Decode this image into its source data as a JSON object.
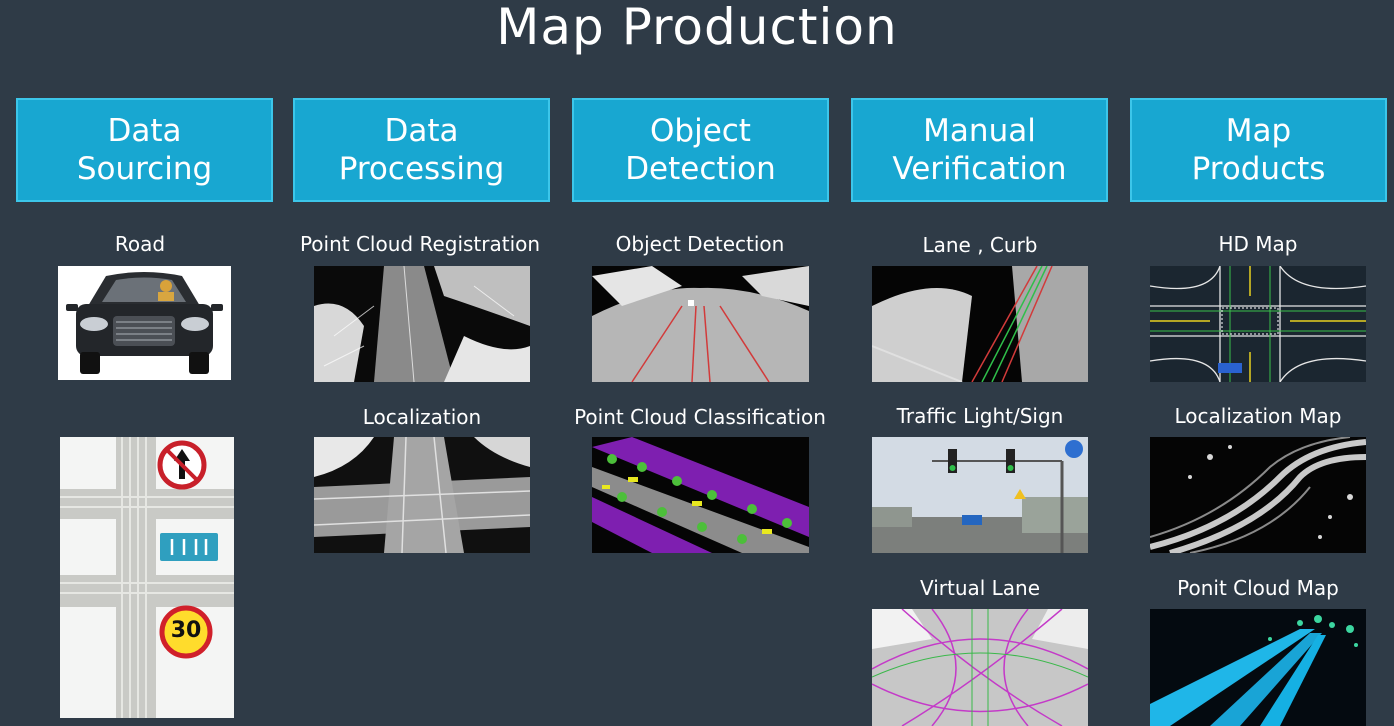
{
  "title": "Map Production",
  "columns": [
    {
      "label": "Data\nSourcing"
    },
    {
      "label": "Data\nProcessing"
    },
    {
      "label": "Object\nDetection"
    },
    {
      "label": "Manual\nVerification"
    },
    {
      "label": "Map\nProducts"
    }
  ],
  "captions": {
    "road": "Road",
    "point_cloud_registration": "Point Cloud Registration",
    "localization": "Localization",
    "object_detection": "Object Detection",
    "point_cloud_classification": "Point Cloud Classification",
    "lane_curb": "Lane , Curb",
    "traffic_light_sign": "Traffic Light/Sign",
    "virtual_lane": "Virtual Lane",
    "hd_map": "HD Map",
    "localization_map": "Localization Map",
    "point_cloud_map": "Ponit Cloud Map"
  },
  "signs": {
    "speed_limit": "30"
  },
  "colors": {
    "background": "#2f3b47",
    "header": "#18a7d1",
    "header_border": "#3cc6ea"
  }
}
